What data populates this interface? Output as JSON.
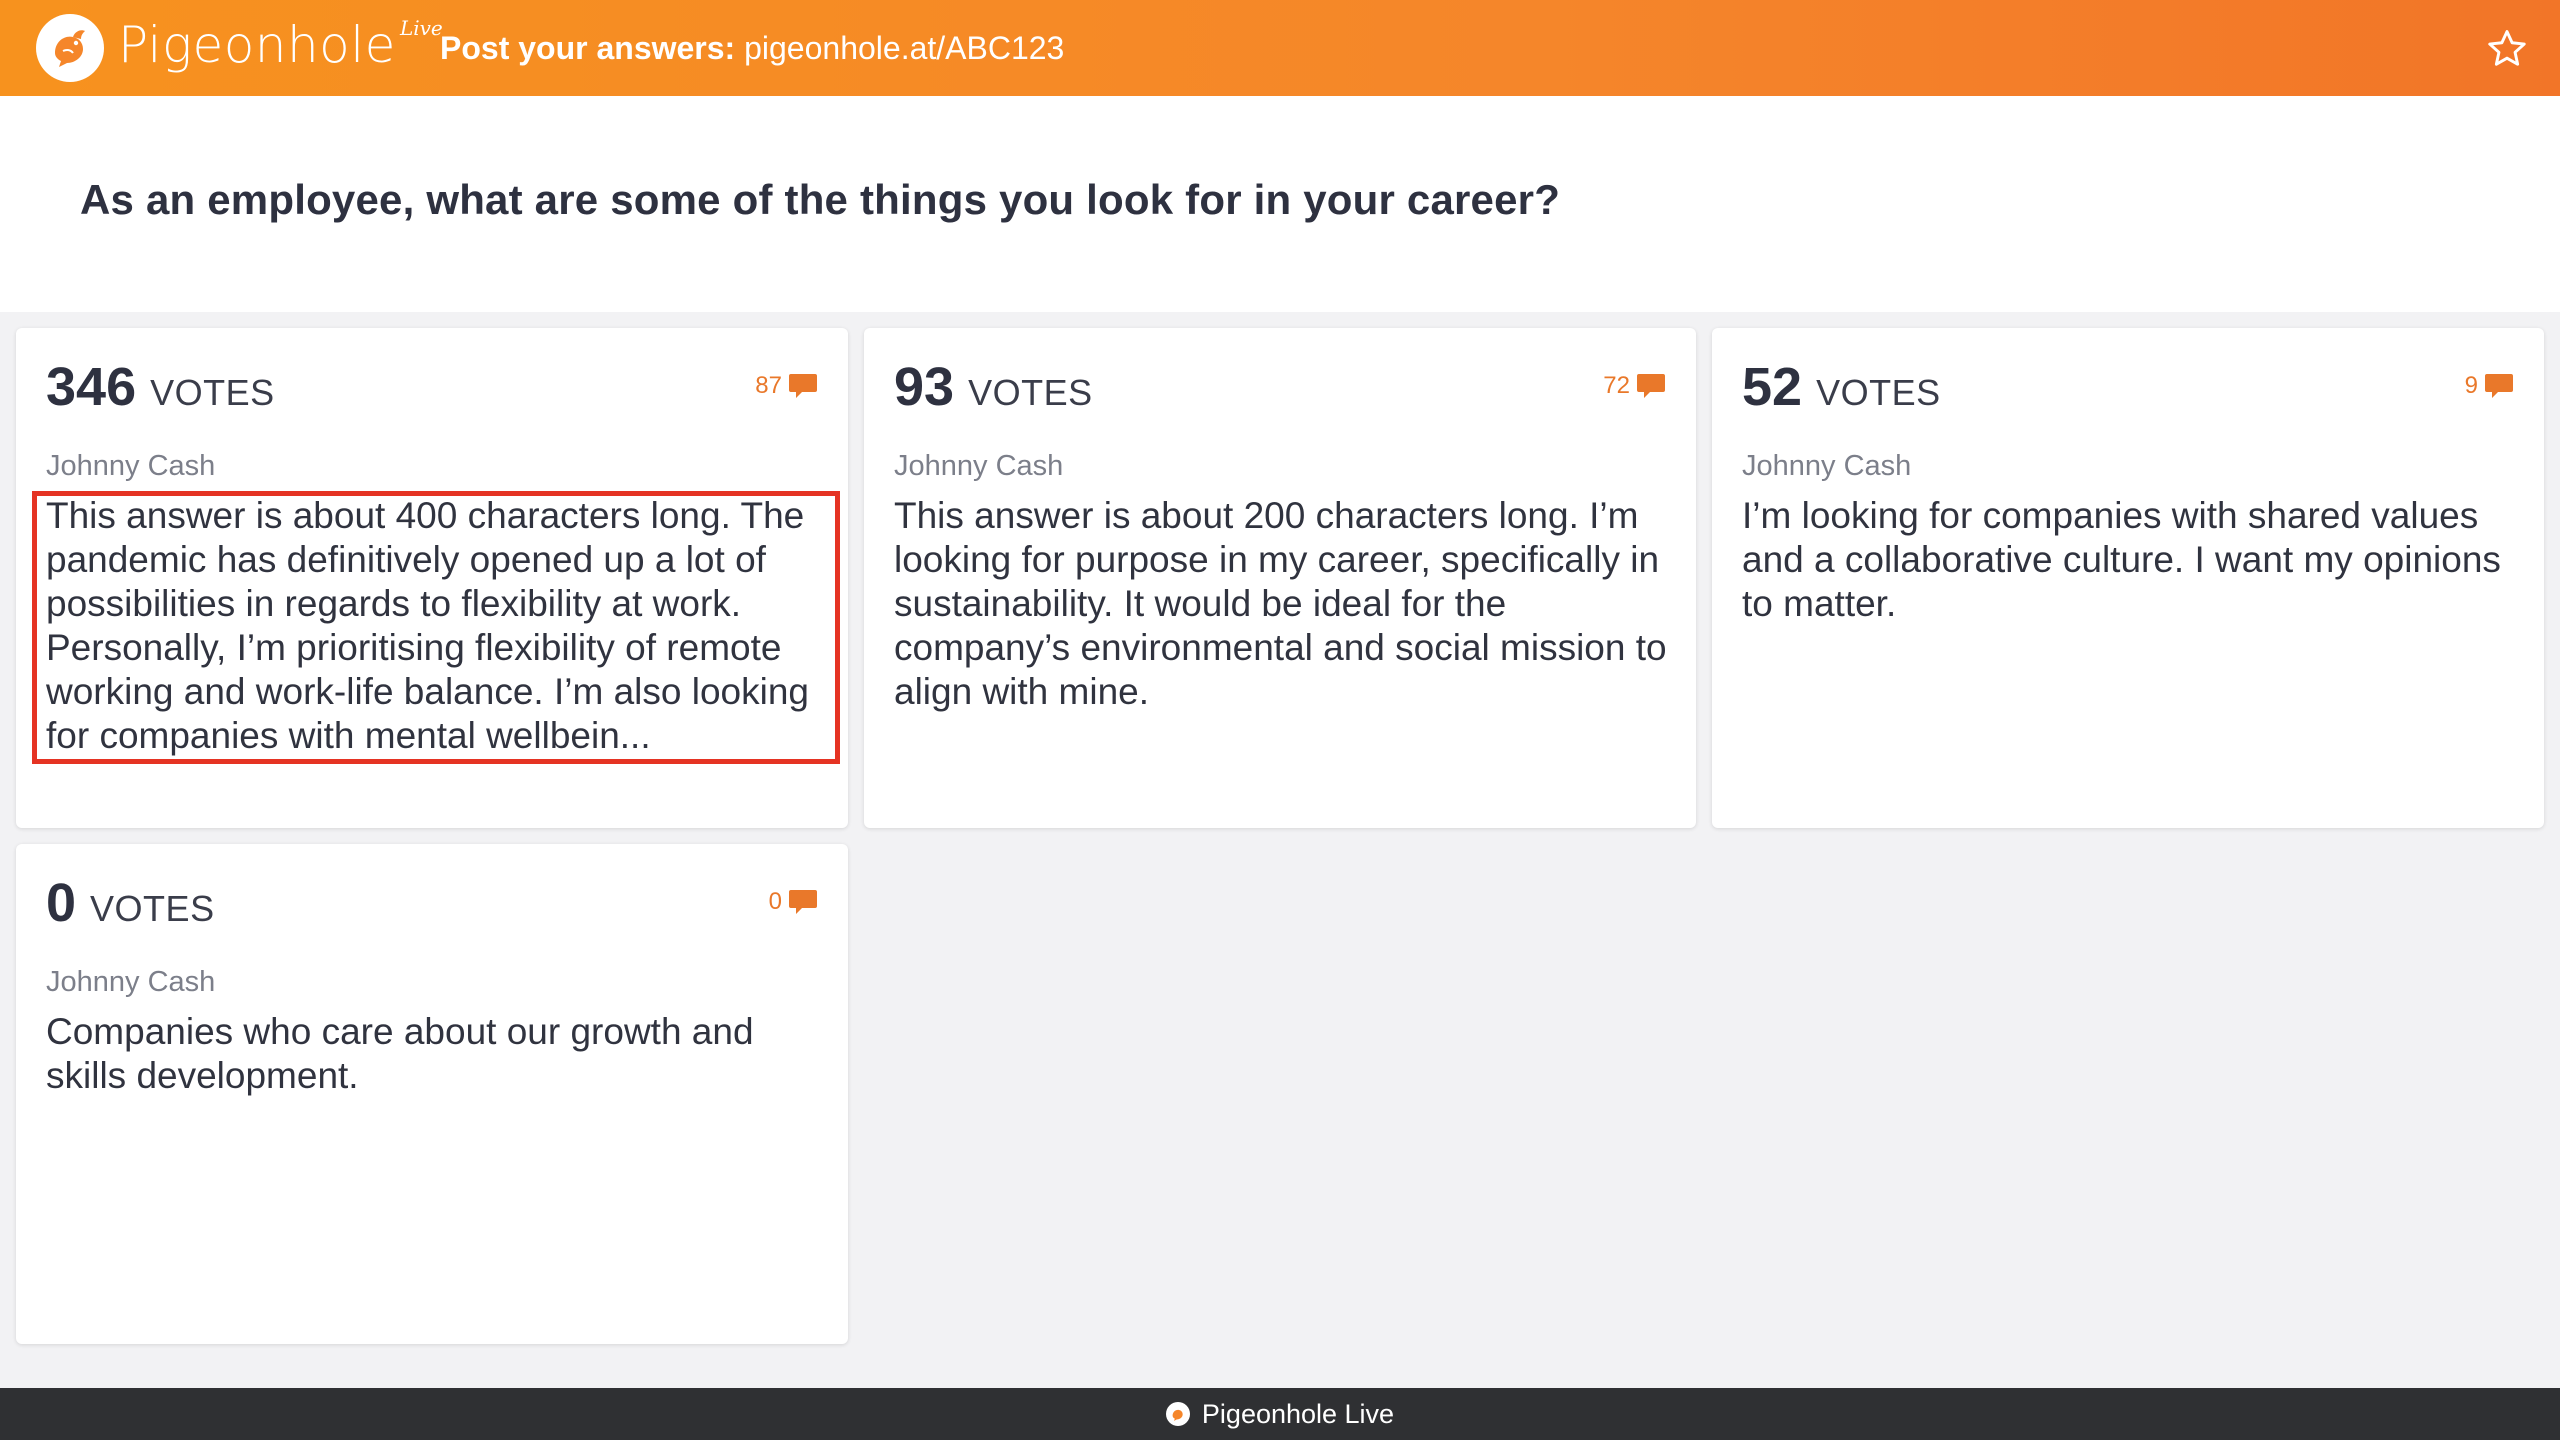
{
  "header": {
    "logo_text": "Pigeonhole",
    "logo_suffix": "Live",
    "post_label": "Post your answers:",
    "post_url": "pigeonhole.at/ABC123",
    "star_icon": "star-icon"
  },
  "question": "As an employee, what are some of the things you look for in your career?",
  "answers": [
    {
      "votes": "346",
      "votes_label": "VOTES",
      "comments": "87",
      "author": "Johnny Cash",
      "text": "This answer is about 400 characters long. The pandemic has definitively opened up a lot of possibilities in regards to flexibility at work. Personally, I’m prioritising flexibility of remote working and work-life balance. I’m also looking for companies with mental wellbein..."
    },
    {
      "votes": "93",
      "votes_label": "VOTES",
      "comments": "72",
      "author": "Johnny Cash",
      "text": "This answer is about 200 characters long. I’m looking for purpose in my career, specifically in sustainability. It would be ideal for the company’s environmental and social mission to align with mine."
    },
    {
      "votes": "52",
      "votes_label": "VOTES",
      "comments": "9",
      "author": "Johnny Cash",
      "text": "I’m looking for companies with shared values and a collaborative culture. I want my opinions to matter."
    },
    {
      "votes": "0",
      "votes_label": "VOTES",
      "comments": "0",
      "author": "Johnny Cash",
      "text": "Companies who care about our growth and skills development."
    }
  ],
  "footer": {
    "label": "Pigeonhole Live"
  },
  "colors": {
    "brand_orange": "#f5862a",
    "comment_orange": "#e9782a",
    "highlight_red": "#e53323",
    "footer_bg": "#2f3033"
  }
}
